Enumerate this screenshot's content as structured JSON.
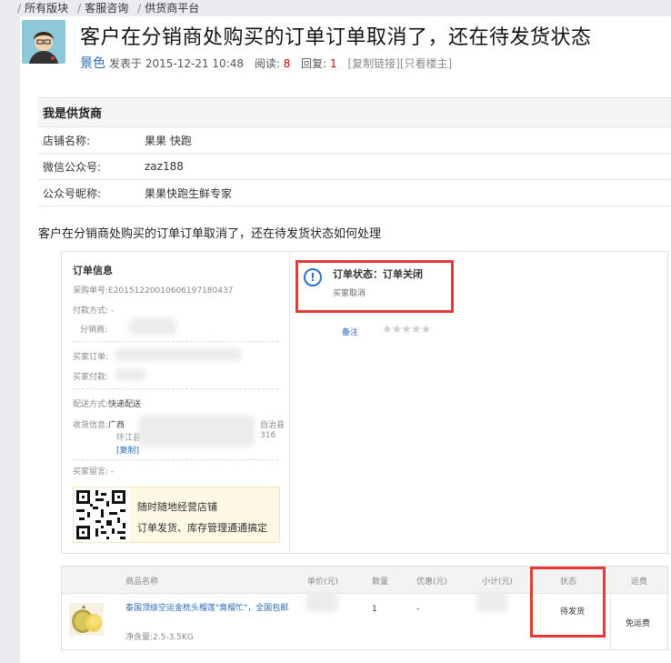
{
  "breadcrumb": [
    "所有版块",
    "客服咨询",
    "供货商平台"
  ],
  "post": {
    "title": "客户在分销商处购买的订单订单取消了，还在待发货状态",
    "author": "景色",
    "posted_label": "发表于",
    "posted_time": "2015-12-21 10:48",
    "views_label": "阅读:",
    "views": "8",
    "replies_label": "回复:",
    "replies": "1",
    "copy_link": "[复制链接]",
    "only_author": "[只看楼主]"
  },
  "supplier": {
    "heading": "我是供货商",
    "rows": [
      {
        "label": "店铺名称:",
        "value": "果果 快跑"
      },
      {
        "label": "微信公众号:",
        "value": "zaz188"
      },
      {
        "label": "公众号昵称:",
        "value": "果果快跑生鲜专家"
      }
    ]
  },
  "question": "客户在分销商处购买的订单订单取消了，还在待发货状态如何处理",
  "order": {
    "info_title": "订单信息",
    "purchase_no_label": "采购单号:",
    "purchase_no": "E20151220010606197180437",
    "pay_method_label": "付款方式:",
    "pay_method": "-",
    "distributor_label": "分销商:",
    "buyer_order_label": "买家订单:",
    "buyer_pay_label": "买家付款:",
    "ship_label": "配送方式:",
    "ship_value": "快递配送",
    "recv_label": "收货信息:",
    "recv_line1_start": "广西",
    "recv_line1_end": "自治县",
    "recv_line2_start": "环江县",
    "recv_line2_end": "316",
    "recv_copy": "[复制]",
    "message_label": "买家留言:",
    "message": "-",
    "promo_line1": "随时随地经营店铺",
    "promo_line2": "订单发货、库存管理通通搞定",
    "status_icon": "!",
    "status_title": "订单状态：订单关闭",
    "status_reason": "买家取消",
    "note_link": "备注",
    "stars": "★★★★★"
  },
  "products": {
    "headers": [
      "商品名称",
      "单价(元)",
      "数量",
      "优惠(元)",
      "小计(元)",
      "状态",
      "运费"
    ],
    "rows": [
      {
        "name": "泰国顶级空运金枕头榴莲\"臭榴忙\"，全国包邮",
        "weight": "净含量:2.5-3.5KG",
        "qty": "1",
        "discount": "-",
        "status": "待发货",
        "freight": "免运费"
      }
    ]
  },
  "colors": {
    "highlight": "#e53935",
    "link": "#2a6ab8",
    "accent_red": "#cc0000"
  }
}
